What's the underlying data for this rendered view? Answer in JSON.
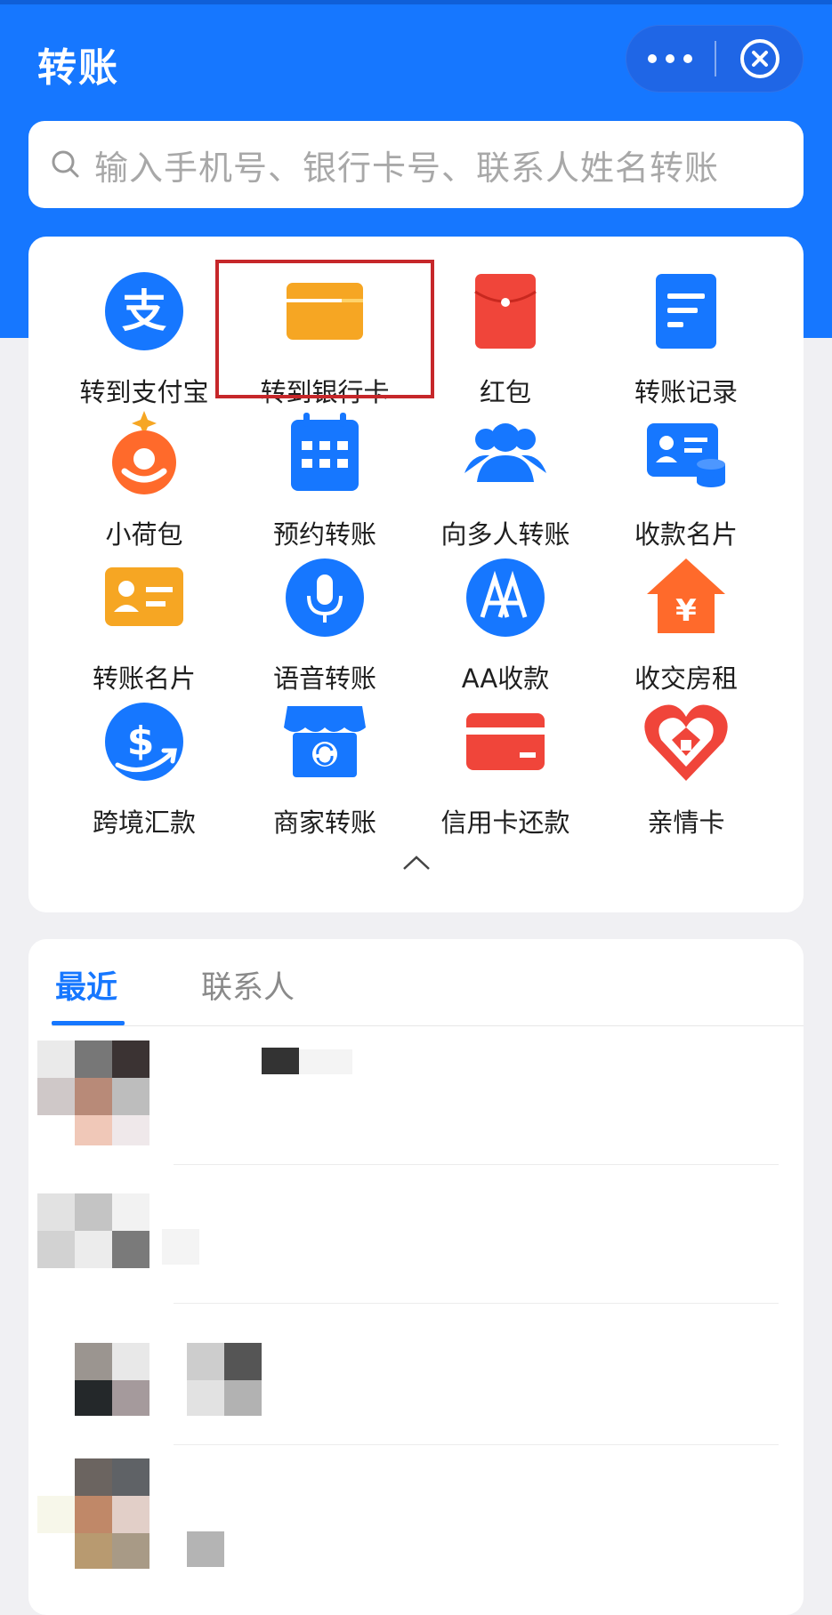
{
  "header": {
    "title": "转账",
    "more_icon": "more-dots-icon",
    "close_icon": "close-circle-icon",
    "bg_color": "#1677ff"
  },
  "search": {
    "placeholder": "输入手机号、银行卡号、联系人姓名转账",
    "icon": "search-icon"
  },
  "grid": [
    {
      "label": "转到支付宝",
      "icon": "alipay-icon"
    },
    {
      "label": "转到银行卡",
      "icon": "bank-card-icon",
      "highlighted": true
    },
    {
      "label": "红包",
      "icon": "red-packet-icon"
    },
    {
      "label": "转账记录",
      "icon": "transfer-record-icon"
    },
    {
      "label": "小荷包",
      "icon": "small-purse-icon"
    },
    {
      "label": "预约转账",
      "icon": "calendar-icon"
    },
    {
      "label": "向多人转账",
      "icon": "multi-user-icon"
    },
    {
      "label": "收款名片",
      "icon": "payment-card-icon"
    },
    {
      "label": "转账名片",
      "icon": "transfer-card-icon"
    },
    {
      "label": "语音转账",
      "icon": "microphone-icon"
    },
    {
      "label": "AA收款",
      "icon": "aa-icon"
    },
    {
      "label": "收交房租",
      "icon": "house-rent-icon"
    },
    {
      "label": "跨境汇款",
      "icon": "cross-border-icon"
    },
    {
      "label": "商家转账",
      "icon": "merchant-icon"
    },
    {
      "label": "信用卡还款",
      "icon": "credit-card-icon"
    },
    {
      "label": "亲情卡",
      "icon": "family-card-icon"
    }
  ],
  "collapse_icon": "chevron-up-icon",
  "tabs": [
    {
      "label": "最近",
      "active": true
    },
    {
      "label": "联系人",
      "active": false
    }
  ],
  "accent_color": "#1677ff"
}
